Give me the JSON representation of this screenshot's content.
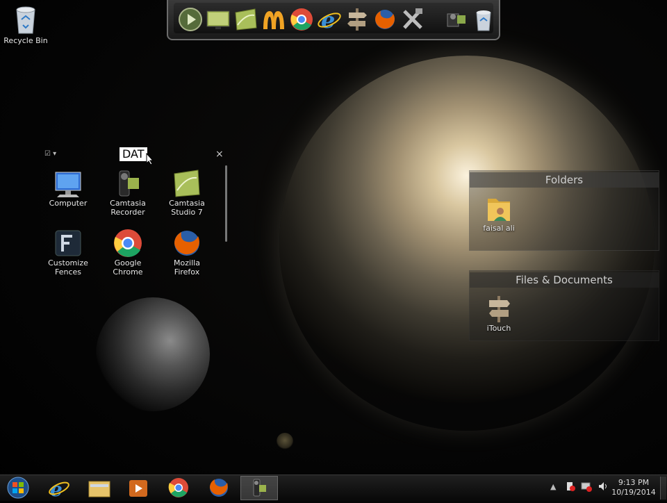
{
  "desktop": {
    "recycle_bin_label": "Recycle Bin"
  },
  "dock": {
    "items": [
      "play-icon",
      "screen-icon",
      "camtasia-studio-icon",
      "m-logo-icon",
      "chrome-icon",
      "ie-icon",
      "signpost-icon",
      "firefox-icon",
      "tools-icon",
      "camera-icon",
      "recycle-icon"
    ]
  },
  "fence": {
    "tab_label": "DAT",
    "close_label": "×",
    "menu_label": "☑ ▾",
    "items": [
      {
        "line1": "Computer",
        "line2": ""
      },
      {
        "line1": "Camtasia",
        "line2": "Recorder"
      },
      {
        "line1": "Camtasia",
        "line2": "Studio 7"
      },
      {
        "line1": "Customize",
        "line2": "Fences"
      },
      {
        "line1": "Google",
        "line2": "Chrome"
      },
      {
        "line1": "Mozilla",
        "line2": "Firefox"
      }
    ]
  },
  "folders_panel": {
    "title": "Folders",
    "item_label": "faisal ali"
  },
  "files_panel": {
    "title": "Files & Documents",
    "item_label": "iTouch"
  },
  "taskbar": {
    "time": "9:13 PM",
    "date": "10/19/2014"
  }
}
